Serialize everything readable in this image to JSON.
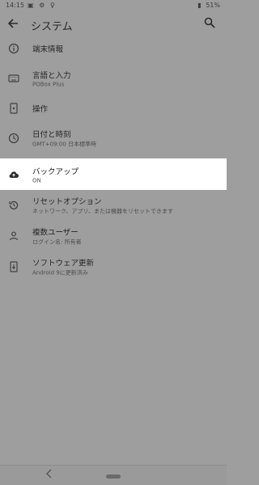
{
  "status_bar": {
    "time": "14:15",
    "battery": "51%"
  },
  "app_bar": {
    "title": "システム",
    "back_icon": "arrow-left-icon",
    "search_icon": "search-icon"
  },
  "items": [
    {
      "label": "端末情報",
      "sub": "",
      "icon": "info-icon"
    },
    {
      "label": "言語と入力",
      "sub": "POBox Plus",
      "icon": "keyboard-icon"
    },
    {
      "label": "操作",
      "sub": "",
      "icon": "gesture-icon"
    },
    {
      "label": "日付と時刻",
      "sub": "GMT+09:00 日本標準時",
      "icon": "clock-icon"
    },
    {
      "label": "バックアップ",
      "sub": "ON",
      "icon": "cloud-upload-icon"
    },
    {
      "label": "リセットオプション",
      "sub": "ネットワーク、アプリ、または機器をリセットできます",
      "icon": "reset-icon"
    },
    {
      "label": "複数ユーザー",
      "sub": "ログイン名: 所有者",
      "icon": "person-icon"
    },
    {
      "label": "ソフトウェア更新",
      "sub": "Android 9に更新済み",
      "icon": "system-update-icon"
    }
  ],
  "colors": {
    "background": "#9e9e9e",
    "highlight": "#ffffff"
  }
}
